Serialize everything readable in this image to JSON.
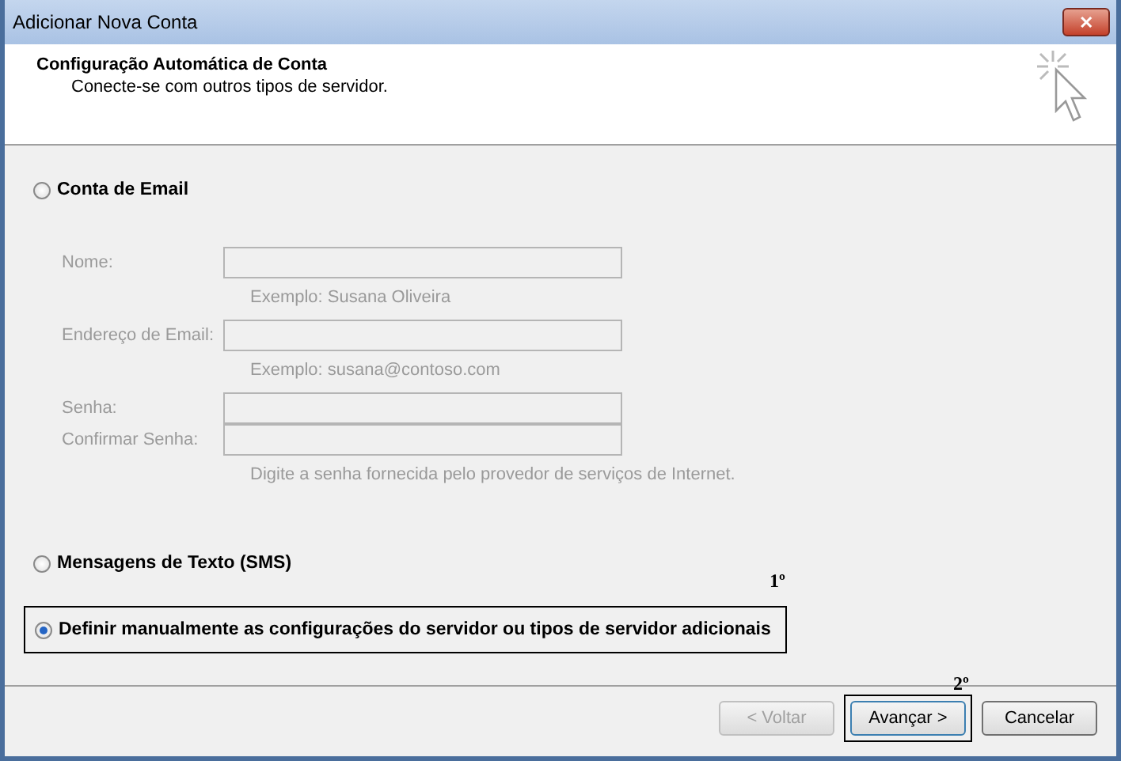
{
  "window": {
    "title": "Adicionar Nova Conta",
    "close_label": "✕"
  },
  "header": {
    "title": "Configuração Automática de Conta",
    "subtitle": "Conecte-se com outros tipos de servidor."
  },
  "options": [
    {
      "kind": "email",
      "label": "Conta de Email",
      "selected": false,
      "disabled_fields": true,
      "fields": [
        {
          "label": "Nome:",
          "hint": "Exemplo: Susana Oliveira"
        },
        {
          "label": "Endereço de Email:",
          "hint": "Exemplo: susana@contoso.com"
        },
        {
          "label": "Senha:"
        },
        {
          "label": "Confirmar Senha:",
          "hint": "Digite a senha fornecida pelo provedor de serviços de Internet."
        }
      ]
    },
    {
      "kind": "plain",
      "label": "Mensagens de Texto (SMS)",
      "selected": false
    },
    {
      "kind": "plain",
      "label": "Definir manualmente as configurações do servidor ou tipos de servidor adicionais",
      "selected": true,
      "annotation": "1º"
    }
  ],
  "buttons": [
    {
      "label": "< Voltar",
      "disabled": true
    },
    {
      "label": "Avançar >",
      "disabled": false,
      "annotation": "2º"
    },
    {
      "label": "Cancelar",
      "disabled": false
    }
  ]
}
